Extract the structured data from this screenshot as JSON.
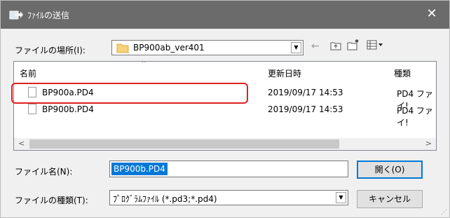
{
  "window": {
    "title": "ﾌｧｲﾙの送信",
    "close_glyph": "✕"
  },
  "location": {
    "label": "ファイルの場所(I):",
    "value": "BP900ab_ver401"
  },
  "toolbar": {
    "back_glyph": "←",
    "up_glyph": "⤒",
    "new_folder_glyph": "✳",
    "view_glyph": "☷"
  },
  "columns": {
    "name": "名前",
    "date": "更新日時",
    "type": "種類"
  },
  "files": [
    {
      "name": "BP900a.PD4",
      "date": "2019/09/17 14:53",
      "type": "PD4 ファイ!"
    },
    {
      "name": "BP900b.PD4",
      "date": "2019/09/17 14:53",
      "type": "PD4 ファイ!"
    }
  ],
  "scroll": {
    "left": "<",
    "right": ">"
  },
  "filename": {
    "label": "ファイル名(N):",
    "value": "BP900b.PD4"
  },
  "filetype": {
    "label": "ファイルの種類(T):",
    "value": "ﾌﾟﾛｸﾞﾗﾑﾌｧｲﾙ (*.pd3;*.pd4)"
  },
  "buttons": {
    "open": "開く(O)",
    "cancel": "キャンセル"
  },
  "colors": {
    "titlebar": "#6b6b6b",
    "selection": "#0078d7",
    "highlight": "#e02020"
  }
}
